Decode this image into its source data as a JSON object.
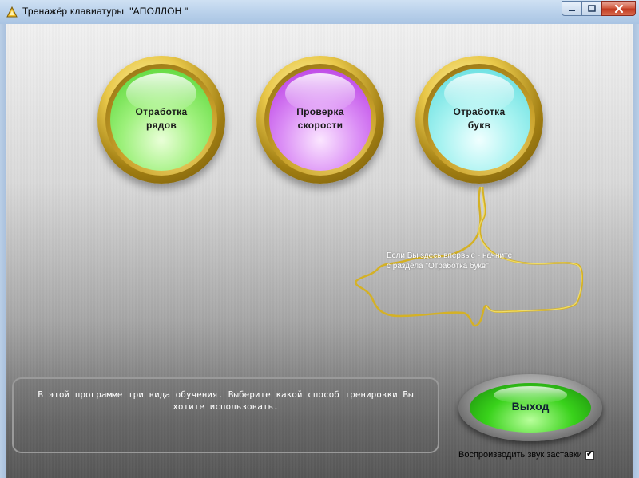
{
  "window": {
    "title": "Тренажёр клавиатуры  \"АПОЛЛОН \"",
    "minimize_icon": "minimize-icon",
    "maximize_icon": "maximize-icon",
    "close_icon": "close-icon"
  },
  "modes": [
    {
      "label": "Отработка\nрядов",
      "color": "#6fe14a"
    },
    {
      "label": "Проверка\nскорости",
      "color": "#cc5cf0"
    },
    {
      "label": "Отработка\nбукв",
      "color": "#7fe8e8"
    }
  ],
  "hint": {
    "text": "Если Вы здесь впервые - начните\nс раздела \"Отработка букв\""
  },
  "info": {
    "text": "В этой программе три вида обучения. Выберите какой способ тренировки Вы хотите использовать."
  },
  "exit_button": {
    "label": "Выход"
  },
  "sound_option": {
    "label": "Воспроизводить звук заставки",
    "checked": true
  }
}
